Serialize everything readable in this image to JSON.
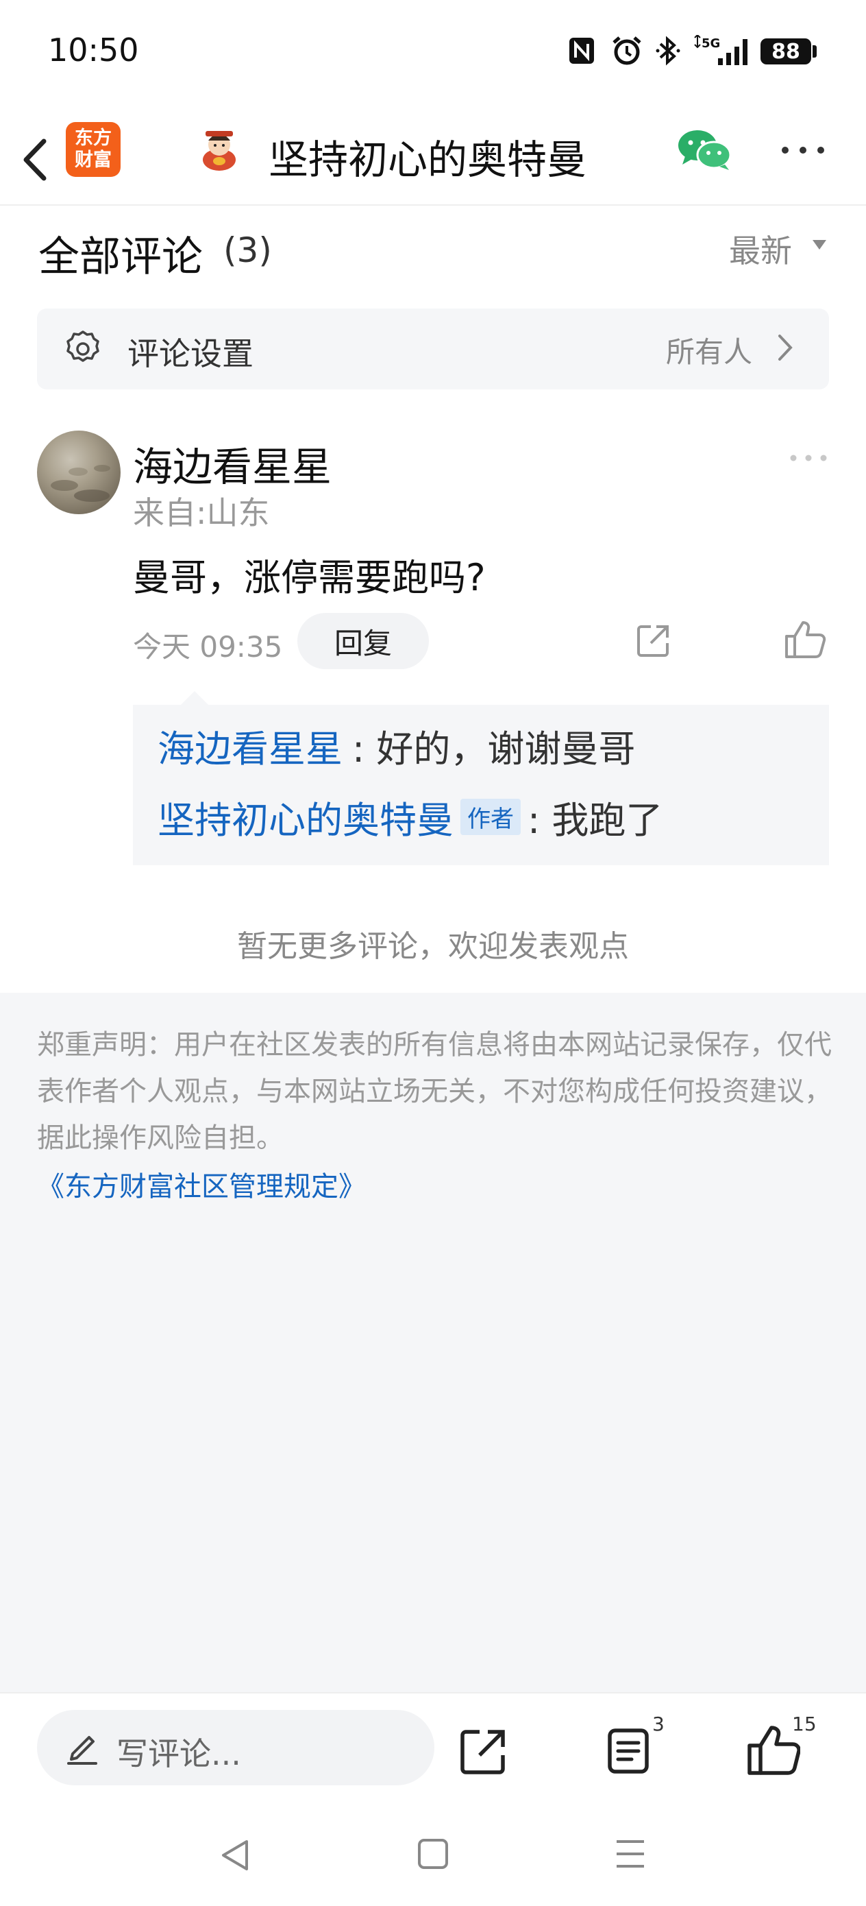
{
  "status_bar": {
    "time": "10:50",
    "battery": "88",
    "icons": [
      "nfc-icon",
      "alarm-icon",
      "bluetooth-icon",
      "5g-signal-icon"
    ]
  },
  "header": {
    "logo_line1": "东方",
    "logo_line2": "财富",
    "title": "坚持初心的奥特曼"
  },
  "comments_section": {
    "title": "全部评论",
    "count": "(3)",
    "sort_label": "最新"
  },
  "settings": {
    "label": "评论设置",
    "value": "所有人"
  },
  "comment": {
    "user": "海边看星星",
    "location": "来自:山东",
    "text": "曼哥，涨停需要跑吗?",
    "time": "今天 09:35",
    "reply_label": "回复",
    "replies": [
      {
        "name": "海边看星星",
        "badge": "",
        "text": ": 好的，谢谢曼哥"
      },
      {
        "name": "坚持初心的奥特曼",
        "badge": "作者",
        "text": ": 我跑了"
      }
    ]
  },
  "no_more_text": "暂无更多评论，欢迎发表观点",
  "disclaimer": {
    "text": "郑重声明：用户在社区发表的所有信息将由本网站记录保存，仅代表作者个人观点，与本网站立场无关，不对您构成任何投资建议，据此操作风险自担。",
    "link": "《东方财富社区管理规定》"
  },
  "bottom_bar": {
    "input_placeholder": "写评论...",
    "list_count": "3",
    "like_count": "15"
  },
  "colors": {
    "brand": "#f3601a",
    "link": "#1565c0",
    "panel_bg": "#f5f6f8",
    "wechat": "#2aae67"
  }
}
